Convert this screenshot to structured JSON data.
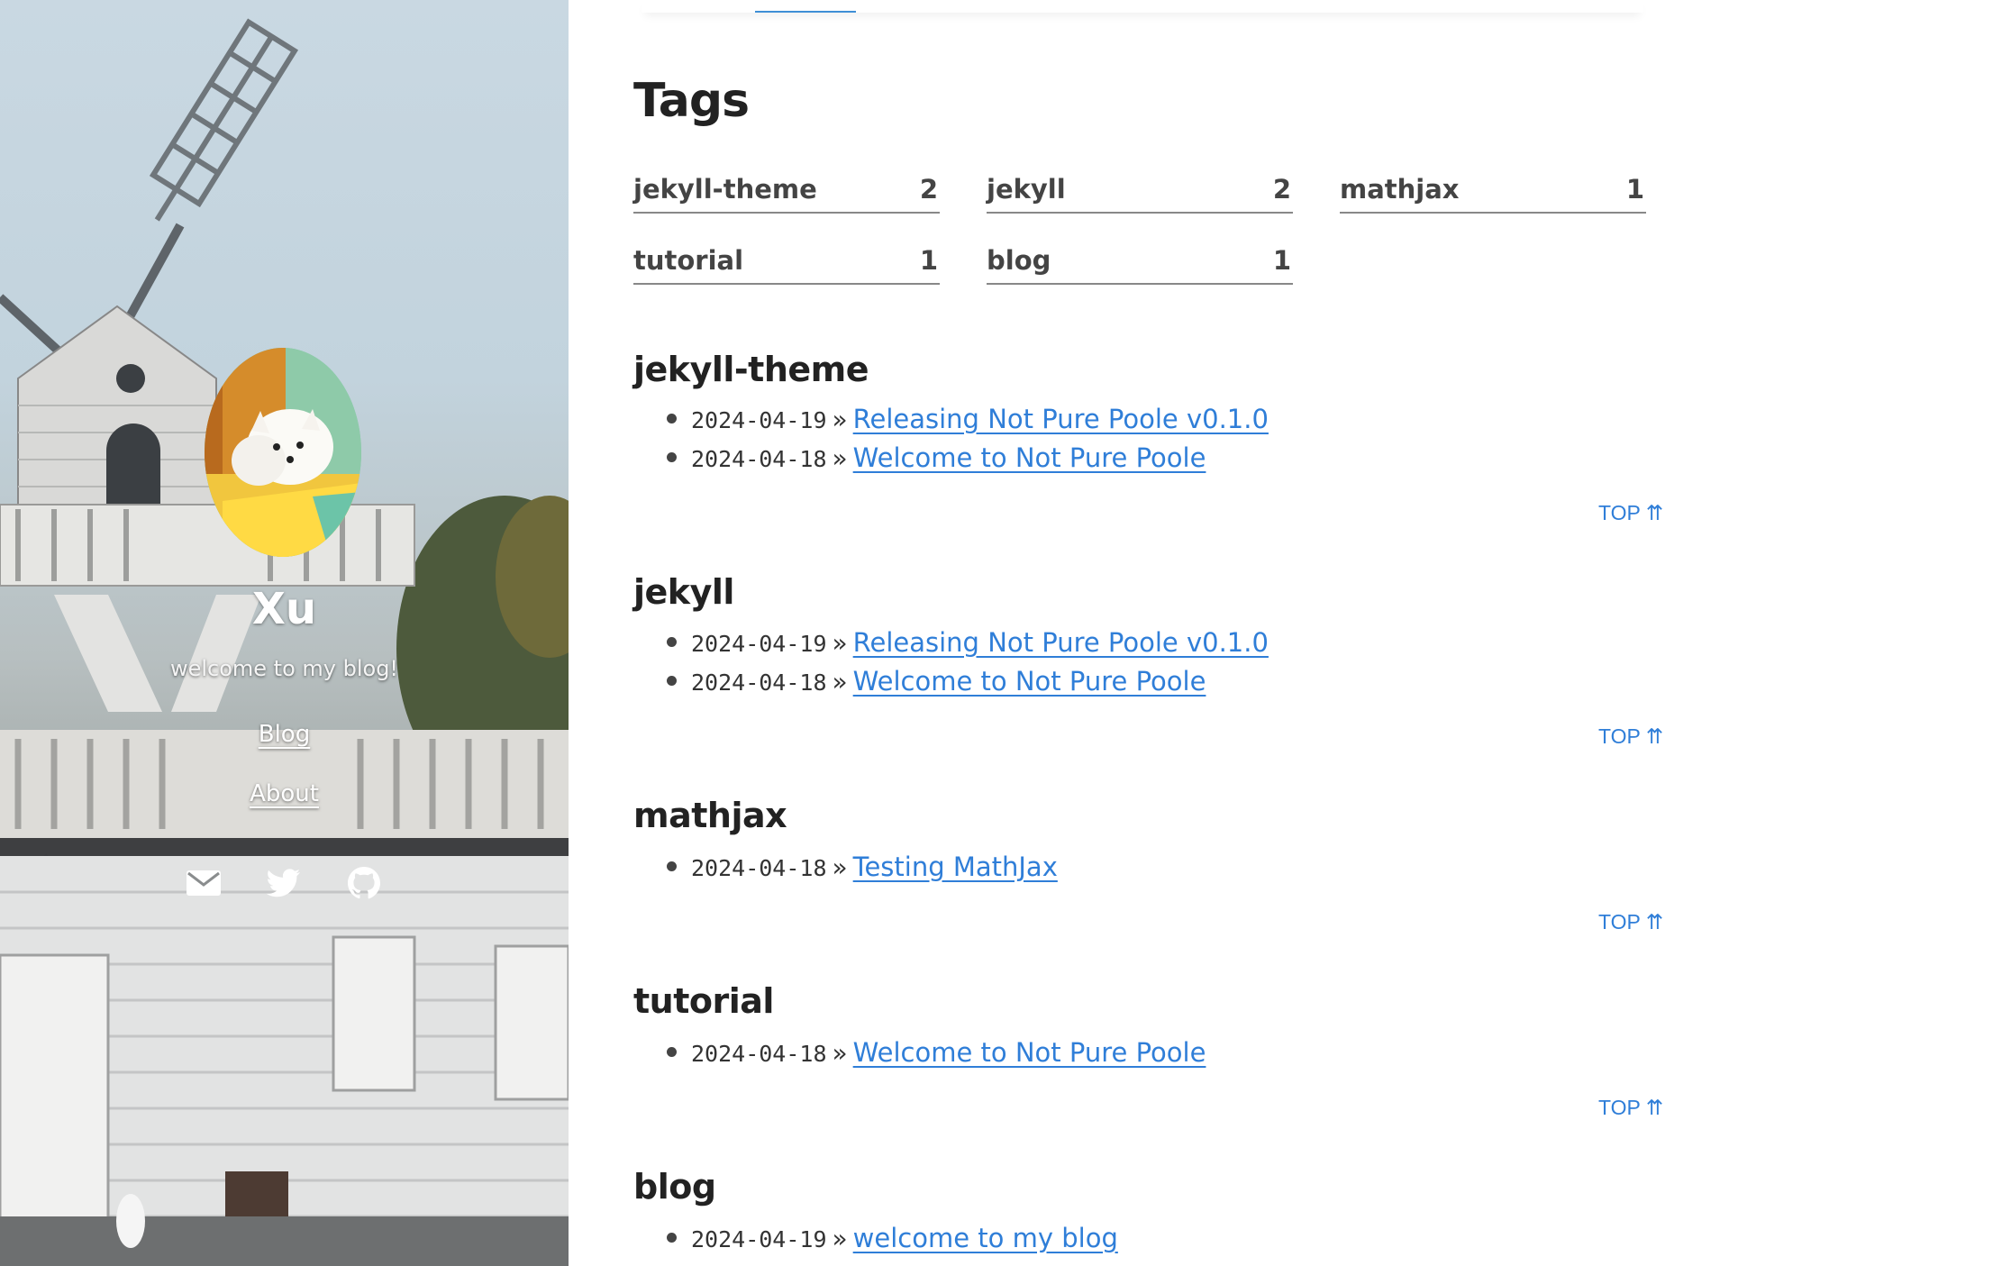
{
  "sidebar": {
    "title": "Xu",
    "subtitle": "welcome to my blog!",
    "nav": [
      {
        "label": "Blog"
      },
      {
        "label": "About"
      }
    ],
    "social_icons": [
      "envelope-icon",
      "twitter-icon",
      "github-icon"
    ]
  },
  "main": {
    "heading": "Tags",
    "tag_counts": [
      {
        "name": "jekyll-theme",
        "count": "2"
      },
      {
        "name": "jekyll",
        "count": "2"
      },
      {
        "name": "mathjax",
        "count": "1"
      },
      {
        "name": "tutorial",
        "count": "1"
      },
      {
        "name": "blog",
        "count": "1"
      }
    ],
    "sections": [
      {
        "title": "jekyll-theme",
        "posts": [
          {
            "date": "2024-04-19",
            "title": "Releasing Not Pure Poole v0.1.0"
          },
          {
            "date": "2024-04-18",
            "title": "Welcome to Not Pure Poole"
          }
        ],
        "top_label": "TOP ⇈"
      },
      {
        "title": "jekyll",
        "posts": [
          {
            "date": "2024-04-19",
            "title": "Releasing Not Pure Poole v0.1.0"
          },
          {
            "date": "2024-04-18",
            "title": "Welcome to Not Pure Poole"
          }
        ],
        "top_label": "TOP ⇈"
      },
      {
        "title": "mathjax",
        "posts": [
          {
            "date": "2024-04-18",
            "title": "Testing MathJax"
          }
        ],
        "top_label": "TOP ⇈"
      },
      {
        "title": "tutorial",
        "posts": [
          {
            "date": "2024-04-18",
            "title": "Welcome to Not Pure Poole"
          }
        ],
        "top_label": "TOP ⇈"
      },
      {
        "title": "blog",
        "posts": [
          {
            "date": "2024-04-19",
            "title": "welcome to my blog"
          }
        ]
      }
    ],
    "separator": "»"
  },
  "colors": {
    "link": "#2f7ed8",
    "text": "#222222"
  }
}
